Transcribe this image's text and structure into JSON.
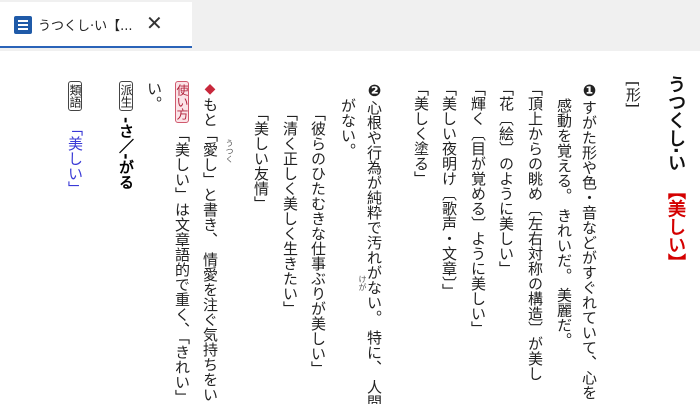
{
  "tab": {
    "title": "うつくし·い【...",
    "close_glyph": "✕",
    "icon": "dictionary-icon"
  },
  "entry": {
    "headword": "うつくし·い",
    "headword_kanji": "【美しい】",
    "pos": "[形]",
    "sense1_num": "❶",
    "sense1_line1": "すがた形や色・音などがすぐれていて、心を",
    "sense1_line2": "感動を覚える。 きれいだ。 美麗だ。",
    "ex1a": "「頂上からの眺め〔左右対称の構造〕が美し",
    "ex1b": "「花〔絵〕のように美しい」",
    "ex1c": "「輝く〔目が覚める〕ように美しい」",
    "ex1d": "「美しい夜明け〔歌声・文章〕」",
    "ex1e": "「美しく塗る」",
    "sense2_num": "❷",
    "sense2_line1": "心根や行為が純粋で汚れがない。 特に、 人間",
    "sense2_line2": "がない。",
    "ex2a": "「彼らのひたむきな仕事ぶりが美しい」",
    "ex2b": "「清く正しく美しく生きたい」",
    "ex2c": "「美しい友情」",
    "ruby_kega": "けが",
    "ruby_utsuku": "うつく",
    "note_diamond": "◆",
    "note_line1": "もと「愛し」と書き、 情愛を注ぐ気持ちをい",
    "note_line2": "い。",
    "usage_label": "使い方",
    "usage_text": "「美しい」は文章語的で重く、「きれい」は",
    "derived_label": "派生",
    "derived_text": "-さ／-がる",
    "synonym_label": "類語",
    "synonym_link": "「美しい」"
  }
}
